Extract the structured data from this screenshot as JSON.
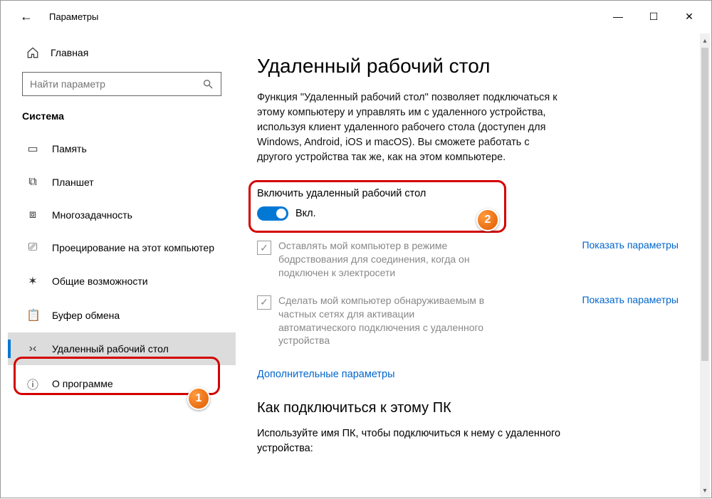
{
  "window": {
    "title": "Параметры",
    "min_icon": "—",
    "max_icon": "☐",
    "close_icon": "✕",
    "back_icon": "←"
  },
  "sidebar": {
    "home": {
      "label": "Главная"
    },
    "search": {
      "placeholder": "Найти параметр"
    },
    "category": "Система",
    "items": [
      {
        "icon": "▭",
        "label": "Память"
      },
      {
        "icon": "⧉",
        "label": "Планшет"
      },
      {
        "icon": "⧈",
        "label": "Многозадачность"
      },
      {
        "icon": "⎚",
        "label": "Проецирование на этот компьютер"
      },
      {
        "icon": "✶",
        "label": "Общие возможности"
      },
      {
        "icon": "📋",
        "label": "Буфер обмена"
      },
      {
        "icon": "›‹",
        "label": "Удаленный рабочий стол"
      },
      {
        "icon": "ⓘ",
        "label": "О программе"
      }
    ],
    "selected_index": 6
  },
  "content": {
    "page_title": "Удаленный рабочий стол",
    "description": "Функция \"Удаленный рабочий стол\" позволяет подключаться к этому компьютеру и управлять им с удаленного устройства, используя клиент удаленного рабочего стола (доступен для Windows, Android, iOS и macOS). Вы сможете работать с другого устройства так же, как на этом компьютере.",
    "toggle": {
      "label": "Включить удаленный рабочий стол",
      "state": "Вкл.",
      "on": true
    },
    "sub_options": [
      {
        "text": "Оставлять мой компьютер в режиме бодрствования для соединения, когда он подключен к электросети",
        "link": "Показать параметры",
        "checked": true
      },
      {
        "text": "Сделать мой компьютер обнаруживаемым в частных сетях для активации автоматического подключения с удаленного устройства",
        "link": "Показать параметры",
        "checked": true
      }
    ],
    "advanced_link": "Дополнительные параметры",
    "section2_title": "Как подключиться к этому ПК",
    "section2_desc": "Используйте имя ПК, чтобы подключиться к нему с удаленного устройства:"
  },
  "annotations": {
    "badge1": "1",
    "badge2": "2"
  }
}
